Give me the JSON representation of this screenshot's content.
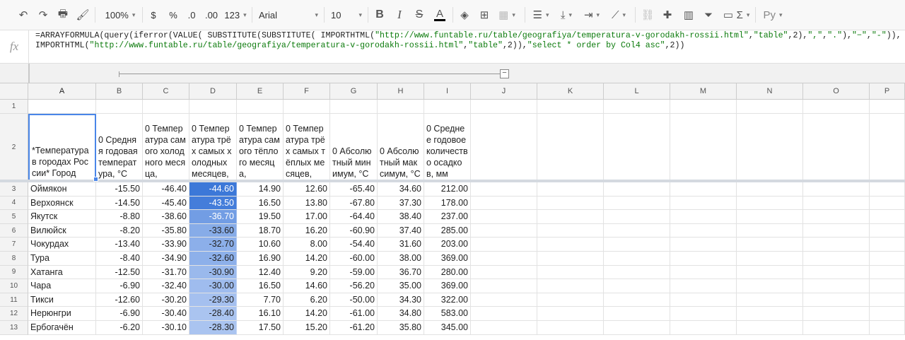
{
  "toolbar": {
    "zoom": "100%",
    "currency": "$",
    "percent": "%",
    "decrease_decimals": ".0",
    "increase_decimals": ".00",
    "more_formats": "123",
    "font": "Arial",
    "font_size": "10",
    "bold": "B",
    "italic": "I",
    "strike": "S",
    "text_color": "A",
    "input_tools": "Ру"
  },
  "formula_bar": {
    "fx": "fx",
    "formula_parts": [
      {
        "t": "=ARRAYFORMULA(query(iferror(VALUE( SUBSTITUTE(SUBSTITUTE( IMPORTHTML(",
        "s": false
      },
      {
        "t": "\"http://www.funtable.ru/table/geografiya/temperatura-v-gorodakh-rossii.html\"",
        "s": true
      },
      {
        "t": ",",
        "s": false
      },
      {
        "t": "\"table\"",
        "s": true
      },
      {
        "t": ",2),",
        "s": false
      },
      {
        "t": "\",\"",
        "s": true
      },
      {
        "t": ",",
        "s": false
      },
      {
        "t": "\".\"",
        "s": true
      },
      {
        "t": "),",
        "s": false
      },
      {
        "t": "\"−\"",
        "s": true
      },
      {
        "t": ",",
        "s": false
      },
      {
        "t": "\"-\"",
        "s": true
      },
      {
        "t": ")),IMPORTHTML(",
        "s": false
      },
      {
        "t": "\"http://www.funtable.ru/table/geografiya/temperatura-v-gorodakh-rossii.html\"",
        "s": true
      },
      {
        "t": ",",
        "s": false
      },
      {
        "t": "\"table\"",
        "s": true
      },
      {
        "t": ",2)),",
        "s": false
      },
      {
        "t": "\"select * order by Col4 asc\"",
        "s": true
      },
      {
        "t": ",2))",
        "s": false
      }
    ]
  },
  "grid": {
    "columns": [
      "A",
      "B",
      "C",
      "D",
      "E",
      "F",
      "G",
      "H",
      "I",
      "J",
      "K",
      "L",
      "M",
      "N",
      "O",
      "P"
    ],
    "header_row": [
      "*Температура в городах России* Город",
      "0 Средняя годовая температура, °C",
      "0 Температура самого холодного месяца,",
      "0 Температура трёх самых холодных месяцев,",
      "0 Температура самого тёплого месяца,",
      "0 Температура трёх самых тёплых месяцев,",
      "0 Абсолютный минимум, °C",
      "0 Абсолютный максимум, °C",
      "0 Среднее годовое количество осадков, мм"
    ],
    "rows": [
      {
        "n": "3",
        "city": "Оймякон",
        "v": [
          "-15.50",
          "-46.40",
          "-44.60",
          "14.90",
          "12.60",
          "-65.40",
          "34.60",
          "212.00"
        ],
        "d": 0.0
      },
      {
        "n": "4",
        "city": "Верхоянск",
        "v": [
          "-14.50",
          "-45.40",
          "-43.50",
          "16.50",
          "13.80",
          "-67.80",
          "37.30",
          "178.00"
        ],
        "d": 0.07
      },
      {
        "n": "5",
        "city": "Якутск",
        "v": [
          "-8.80",
          "-38.60",
          "-36.70",
          "19.50",
          "17.00",
          "-64.40",
          "38.40",
          "237.00"
        ],
        "d": 0.49
      },
      {
        "n": "6",
        "city": "Вилюйск",
        "v": [
          "-8.20",
          "-35.80",
          "-33.60",
          "18.70",
          "16.20",
          "-60.90",
          "37.40",
          "285.00"
        ],
        "d": 0.68
      },
      {
        "n": "7",
        "city": "Чокурдах",
        "v": [
          "-13.40",
          "-33.90",
          "-32.70",
          "10.60",
          "8.00",
          "-54.40",
          "31.60",
          "203.00"
        ],
        "d": 0.73
      },
      {
        "n": "8",
        "city": "Тура",
        "v": [
          "-8.40",
          "-34.90",
          "-32.60",
          "16.90",
          "14.20",
          "-60.00",
          "38.00",
          "369.00"
        ],
        "d": 0.74
      },
      {
        "n": "9",
        "city": "Хатанга",
        "v": [
          "-12.50",
          "-31.70",
          "-30.90",
          "12.40",
          "9.20",
          "-59.00",
          "36.70",
          "280.00"
        ],
        "d": 0.85
      },
      {
        "n": "10",
        "city": "Чара",
        "v": [
          "-6.90",
          "-32.40",
          "-30.00",
          "16.50",
          "14.60",
          "-56.20",
          "35.00",
          "369.00"
        ],
        "d": 0.9
      },
      {
        "n": "11",
        "city": "Тикси",
        "v": [
          "-12.60",
          "-30.20",
          "-29.30",
          "7.70",
          "6.20",
          "-50.00",
          "34.30",
          "322.00"
        ],
        "d": 0.95
      },
      {
        "n": "12",
        "city": "Нерюнгри",
        "v": [
          "-6.90",
          "-30.40",
          "-28.40",
          "16.10",
          "14.20",
          "-61.00",
          "34.80",
          "583.00"
        ],
        "d": 1.0
      },
      {
        "n": "13",
        "city": "Ербогачён",
        "v": [
          "-6.20",
          "-30.10",
          "-28.30",
          "17.50",
          "15.20",
          "-61.20",
          "35.80",
          "345.00"
        ],
        "d": 1.0
      }
    ]
  },
  "colors": {
    "scale_dark": "#3c78d8",
    "scale_light": "#aac4f0",
    "formula_string": "#0b7a0b",
    "selection": "#4a86e8"
  }
}
